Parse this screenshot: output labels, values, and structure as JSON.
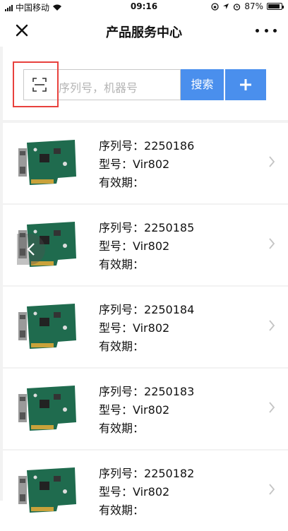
{
  "status_bar": {
    "carrier": "中国移动",
    "time": "09:16",
    "battery": "87%",
    "battery_level": 0.87
  },
  "nav": {
    "title": "产品服务中心"
  },
  "search": {
    "placeholder": "序列号，机器号",
    "button_label": "搜索",
    "add_label": "+"
  },
  "products": [
    {
      "serial_label": "序列号：",
      "serial": "2250186",
      "model_label": "型号：",
      "model": "Vir802",
      "validity_label": "有效期：",
      "validity": ""
    },
    {
      "serial_label": "序列号：",
      "serial": "2250185",
      "model_label": "型号：",
      "model": "Vir802",
      "validity_label": "有效期：",
      "validity": ""
    },
    {
      "serial_label": "序列号：",
      "serial": "2250184",
      "model_label": "型号：",
      "model": "Vir802",
      "validity_label": "有效期：",
      "validity": ""
    },
    {
      "serial_label": "序列号：",
      "serial": "2250183",
      "model_label": "型号：",
      "model": "Vir802",
      "validity_label": "有效期：",
      "validity": ""
    },
    {
      "serial_label": "序列号：",
      "serial": "2250182",
      "model_label": "型号：",
      "model": "Vir802",
      "validity_label": "有效期：",
      "validity": ""
    }
  ],
  "colors": {
    "accent": "#4a8fed",
    "highlight": "#e8413d",
    "board": "#1f6b4e"
  }
}
